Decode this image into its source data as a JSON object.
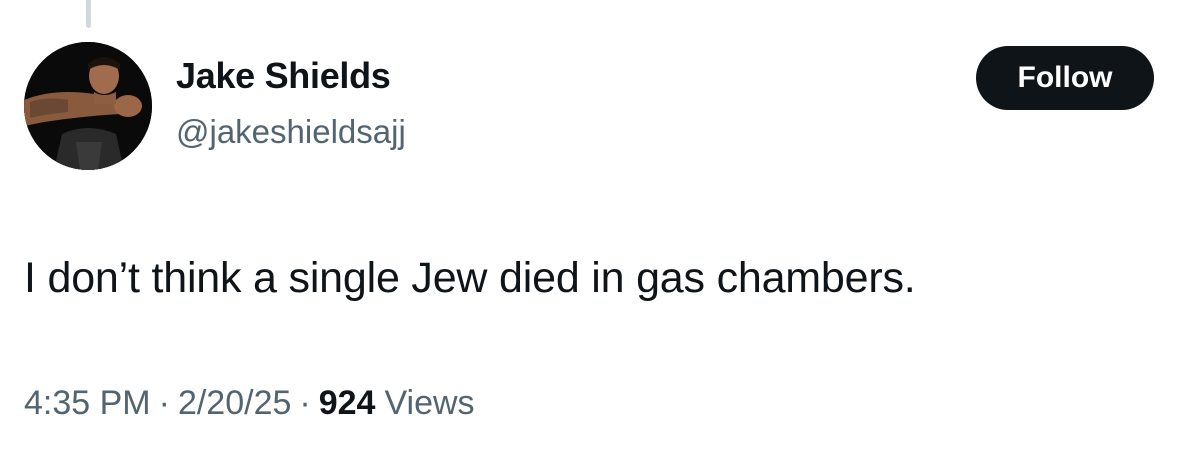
{
  "tweet": {
    "author": {
      "display_name": "Jake Shields",
      "handle": "@jakeshieldsajj",
      "avatar_icon": "profile-photo"
    },
    "follow_label": "Follow",
    "text": "I don’t think a single Jew died in gas chambers.",
    "time": "4:35 PM",
    "separator": "·",
    "date": "2/20/25",
    "views_count": "924",
    "views_label": "Views"
  },
  "colors": {
    "text_primary": "#0f1419",
    "text_secondary": "#536471",
    "follow_button_bg": "#0f1419",
    "follow_button_text": "#ffffff",
    "thread_line": "#cfd9de"
  }
}
